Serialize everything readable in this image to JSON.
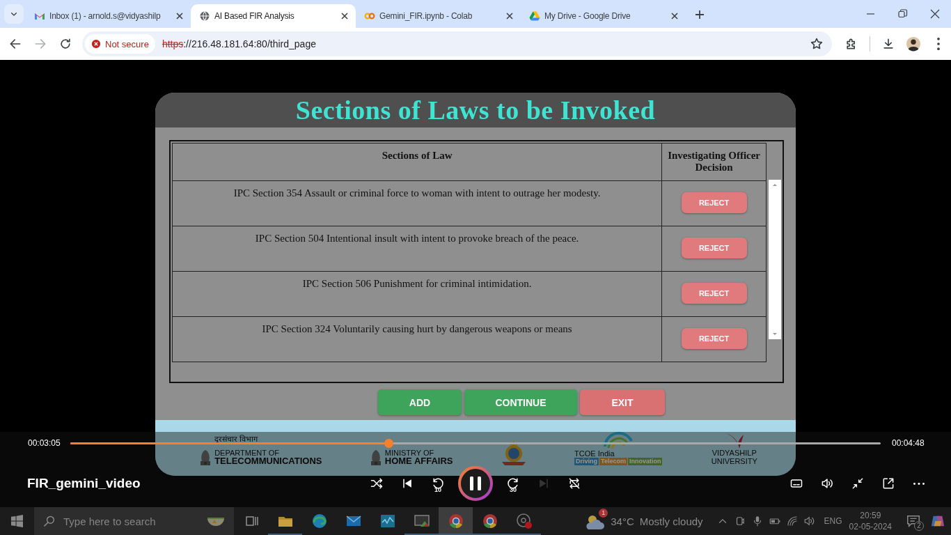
{
  "browser": {
    "tabs": [
      {
        "kind": "gmail",
        "title": "Inbox (1) - arnold.s@vidyashilp",
        "selected": false
      },
      {
        "kind": "globe",
        "title": "AI Based FIR Analysis",
        "selected": true
      },
      {
        "kind": "colab",
        "title": "Gemini_FIR.ipynb - Colab",
        "selected": false
      },
      {
        "kind": "drive",
        "title": "My Drive - Google Drive",
        "selected": false
      }
    ],
    "security": "Not secure",
    "url_scheme": "https",
    "url_rest": "://216.48.181.64:80/third_page"
  },
  "page": {
    "title": "Sections of Laws to be Invoked",
    "table": {
      "columns": [
        "Sections of Law",
        "Investigating Officer Decision"
      ],
      "rows": [
        {
          "section": "IPC Section 354 Assault or criminal force to woman with intent to outrage her modesty.",
          "action": "REJECT"
        },
        {
          "section": "IPC Section 504 Intentional insult with intent to provoke breach of the peace.",
          "action": "REJECT"
        },
        {
          "section": "IPC Section 506 Punishment for criminal intimidation.",
          "action": "REJECT"
        },
        {
          "section": "IPC Section 324 Voluntarily causing hurt by dangerous weapons or means",
          "action": "REJECT"
        }
      ]
    },
    "buttons": [
      {
        "kind": "add",
        "label": "ADD"
      },
      {
        "kind": "continue",
        "label": "CONTINUE"
      },
      {
        "kind": "exit",
        "label": "EXIT"
      }
    ],
    "footer_logos": [
      {
        "kind": "emblem",
        "lines": [
          "दूरसंचार विभाग",
          "DEPARTMENT OF",
          "TELECOMMUNICATIONS"
        ]
      },
      {
        "kind": "emblem",
        "lines": [
          "MINISTRY OF",
          "HOME AFFAIRS"
        ]
      },
      {
        "kind": "crest"
      },
      {
        "kind": "tcoe",
        "lines": [
          "TCOE India"
        ],
        "tags": [
          "Driving",
          "Telecom",
          "Innovation"
        ]
      },
      {
        "kind": "swoosh",
        "lines": [
          "VIDYASHILP",
          "UNIVERSITY"
        ]
      }
    ]
  },
  "player": {
    "elapsed": "00:03:05",
    "duration": "00:04:48",
    "progress": {
      "level": 0.393
    },
    "title": "FIR_gemini_video",
    "playing": true,
    "controls": [
      {
        "kind": "shuffle",
        "disabled": false
      },
      {
        "kind": "previous",
        "disabled": false
      },
      {
        "kind": "rewind",
        "label": "10",
        "disabled": false
      },
      {
        "kind": "play",
        "disabled": false
      },
      {
        "kind": "forward",
        "label": "30",
        "disabled": false
      },
      {
        "kind": "next",
        "disabled": true
      },
      {
        "kind": "repeat",
        "disabled": false
      }
    ]
  },
  "taskbar": {
    "search_placeholder": "Type here to search",
    "apps": [
      {
        "kind": "taskview",
        "open": false,
        "selected": false
      },
      {
        "kind": "folder",
        "open": true,
        "selected": false
      },
      {
        "kind": "edge",
        "open": false,
        "selected": false
      },
      {
        "kind": "mail",
        "open": false,
        "selected": false
      },
      {
        "kind": "chart",
        "open": false,
        "selected": false
      },
      {
        "kind": "monitor",
        "open": true,
        "selected": false
      },
      {
        "kind": "chrome",
        "open": true,
        "selected": true
      },
      {
        "kind": "chrome",
        "open": true,
        "selected": false
      },
      {
        "kind": "recorder",
        "open": true,
        "selected": false
      }
    ],
    "weather": {
      "badge": "1",
      "temperature": "34°C",
      "condition": "Mostly cloudy"
    },
    "language": "ENG",
    "time": "20:59",
    "date": "02-05-2024",
    "notifications": "2"
  }
}
